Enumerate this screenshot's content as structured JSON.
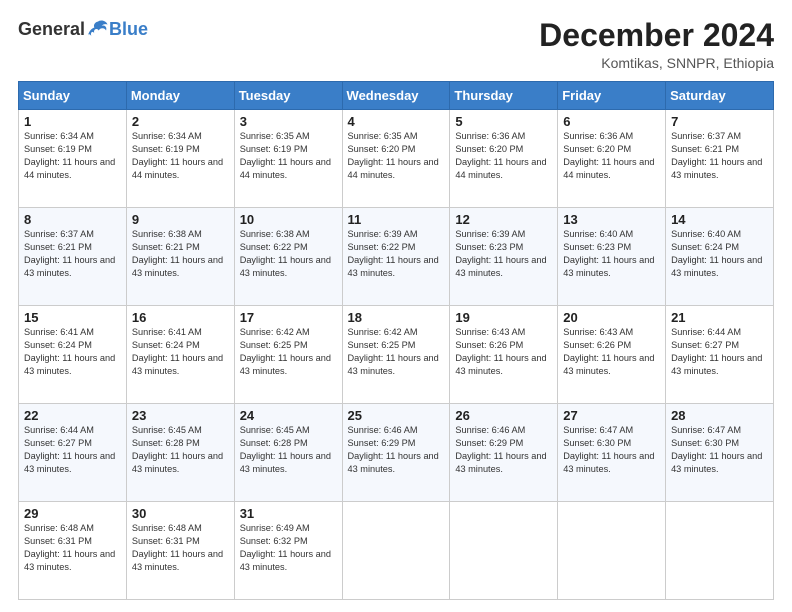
{
  "header": {
    "logo_general": "General",
    "logo_blue": "Blue",
    "month_title": "December 2024",
    "location": "Komtikas, SNNPR, Ethiopia"
  },
  "days_of_week": [
    "Sunday",
    "Monday",
    "Tuesday",
    "Wednesday",
    "Thursday",
    "Friday",
    "Saturday"
  ],
  "weeks": [
    [
      {
        "day": "1",
        "sunrise": "6:34 AM",
        "sunset": "6:19 PM",
        "daylight": "11 hours and 44 minutes."
      },
      {
        "day": "2",
        "sunrise": "6:34 AM",
        "sunset": "6:19 PM",
        "daylight": "11 hours and 44 minutes."
      },
      {
        "day": "3",
        "sunrise": "6:35 AM",
        "sunset": "6:19 PM",
        "daylight": "11 hours and 44 minutes."
      },
      {
        "day": "4",
        "sunrise": "6:35 AM",
        "sunset": "6:20 PM",
        "daylight": "11 hours and 44 minutes."
      },
      {
        "day": "5",
        "sunrise": "6:36 AM",
        "sunset": "6:20 PM",
        "daylight": "11 hours and 44 minutes."
      },
      {
        "day": "6",
        "sunrise": "6:36 AM",
        "sunset": "6:20 PM",
        "daylight": "11 hours and 44 minutes."
      },
      {
        "day": "7",
        "sunrise": "6:37 AM",
        "sunset": "6:21 PM",
        "daylight": "11 hours and 43 minutes."
      }
    ],
    [
      {
        "day": "8",
        "sunrise": "6:37 AM",
        "sunset": "6:21 PM",
        "daylight": "11 hours and 43 minutes."
      },
      {
        "day": "9",
        "sunrise": "6:38 AM",
        "sunset": "6:21 PM",
        "daylight": "11 hours and 43 minutes."
      },
      {
        "day": "10",
        "sunrise": "6:38 AM",
        "sunset": "6:22 PM",
        "daylight": "11 hours and 43 minutes."
      },
      {
        "day": "11",
        "sunrise": "6:39 AM",
        "sunset": "6:22 PM",
        "daylight": "11 hours and 43 minutes."
      },
      {
        "day": "12",
        "sunrise": "6:39 AM",
        "sunset": "6:23 PM",
        "daylight": "11 hours and 43 minutes."
      },
      {
        "day": "13",
        "sunrise": "6:40 AM",
        "sunset": "6:23 PM",
        "daylight": "11 hours and 43 minutes."
      },
      {
        "day": "14",
        "sunrise": "6:40 AM",
        "sunset": "6:24 PM",
        "daylight": "11 hours and 43 minutes."
      }
    ],
    [
      {
        "day": "15",
        "sunrise": "6:41 AM",
        "sunset": "6:24 PM",
        "daylight": "11 hours and 43 minutes."
      },
      {
        "day": "16",
        "sunrise": "6:41 AM",
        "sunset": "6:24 PM",
        "daylight": "11 hours and 43 minutes."
      },
      {
        "day": "17",
        "sunrise": "6:42 AM",
        "sunset": "6:25 PM",
        "daylight": "11 hours and 43 minutes."
      },
      {
        "day": "18",
        "sunrise": "6:42 AM",
        "sunset": "6:25 PM",
        "daylight": "11 hours and 43 minutes."
      },
      {
        "day": "19",
        "sunrise": "6:43 AM",
        "sunset": "6:26 PM",
        "daylight": "11 hours and 43 minutes."
      },
      {
        "day": "20",
        "sunrise": "6:43 AM",
        "sunset": "6:26 PM",
        "daylight": "11 hours and 43 minutes."
      },
      {
        "day": "21",
        "sunrise": "6:44 AM",
        "sunset": "6:27 PM",
        "daylight": "11 hours and 43 minutes."
      }
    ],
    [
      {
        "day": "22",
        "sunrise": "6:44 AM",
        "sunset": "6:27 PM",
        "daylight": "11 hours and 43 minutes."
      },
      {
        "day": "23",
        "sunrise": "6:45 AM",
        "sunset": "6:28 PM",
        "daylight": "11 hours and 43 minutes."
      },
      {
        "day": "24",
        "sunrise": "6:45 AM",
        "sunset": "6:28 PM",
        "daylight": "11 hours and 43 minutes."
      },
      {
        "day": "25",
        "sunrise": "6:46 AM",
        "sunset": "6:29 PM",
        "daylight": "11 hours and 43 minutes."
      },
      {
        "day": "26",
        "sunrise": "6:46 AM",
        "sunset": "6:29 PM",
        "daylight": "11 hours and 43 minutes."
      },
      {
        "day": "27",
        "sunrise": "6:47 AM",
        "sunset": "6:30 PM",
        "daylight": "11 hours and 43 minutes."
      },
      {
        "day": "28",
        "sunrise": "6:47 AM",
        "sunset": "6:30 PM",
        "daylight": "11 hours and 43 minutes."
      }
    ],
    [
      {
        "day": "29",
        "sunrise": "6:48 AM",
        "sunset": "6:31 PM",
        "daylight": "11 hours and 43 minutes."
      },
      {
        "day": "30",
        "sunrise": "6:48 AM",
        "sunset": "6:31 PM",
        "daylight": "11 hours and 43 minutes."
      },
      {
        "day": "31",
        "sunrise": "6:49 AM",
        "sunset": "6:32 PM",
        "daylight": "11 hours and 43 minutes."
      },
      null,
      null,
      null,
      null
    ]
  ]
}
